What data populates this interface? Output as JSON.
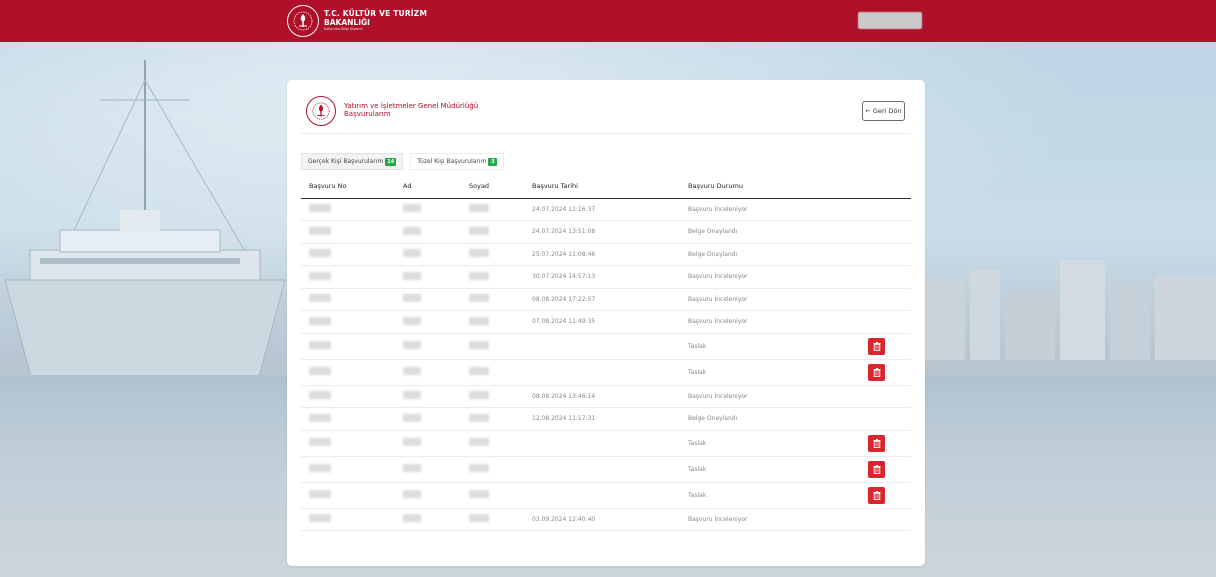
{
  "header": {
    "ministry_line1": "T.C. KÜLTÜR VE TURİZM",
    "ministry_line2": "BAKANLIĞI",
    "ministry_line3": "Kalkınma Bilgi Sistemi"
  },
  "card": {
    "department": "Yatırım ve İşletmeler Genel Müdürlüğü",
    "page_title": "Başvurularım",
    "back_button": "← Geri Dön"
  },
  "tabs": [
    {
      "label": "Gerçek Kişi Başvurularım",
      "count": "14",
      "active": true
    },
    {
      "label": "Tüzel Kişi Başvurularım",
      "count": "3",
      "active": false
    }
  ],
  "table": {
    "columns": [
      "Başvuru No",
      "Ad",
      "Soyad",
      "Başvuru Tarihi",
      "Başvuru Durumu"
    ],
    "rows": [
      {
        "date": "24.07.2024 12:16:37",
        "status": "Başvuru İnceleniyor",
        "deletable": false
      },
      {
        "date": "24.07.2024 13:51:08",
        "status": "Belge Onaylandı",
        "deletable": false
      },
      {
        "date": "25.07.2024 11:08:46",
        "status": "Belge Onaylandı",
        "deletable": false
      },
      {
        "date": "30.07.2024 14:57:13",
        "status": "Başvuru İnceleniyor",
        "deletable": false
      },
      {
        "date": "08.08.2024 17:22:57",
        "status": "Başvuru İnceleniyor",
        "deletable": false
      },
      {
        "date": "07.08.2024 11:49:35",
        "status": "Başvuru İnceleniyor",
        "deletable": false
      },
      {
        "date": "",
        "status": "Taslak",
        "deletable": true
      },
      {
        "date": "",
        "status": "Taslak",
        "deletable": true
      },
      {
        "date": "08.08.2024 13:46:14",
        "status": "Başvuru İnceleniyor",
        "deletable": false
      },
      {
        "date": "12.08.2024 11:17:31",
        "status": "Belge Onaylandı",
        "deletable": false
      },
      {
        "date": "",
        "status": "Taslak",
        "deletable": true
      },
      {
        "date": "",
        "status": "Taslak",
        "deletable": true
      },
      {
        "date": "",
        "status": "Taslak",
        "deletable": true
      },
      {
        "date": "03.09.2024 12:40:40",
        "status": "Başvuru İnceleniyor",
        "deletable": false
      }
    ]
  },
  "colors": {
    "brand_red": "#b0102a",
    "delete_red": "#d9262e",
    "badge_green": "#28a745"
  },
  "icons": {
    "seal": "ministry-seal-icon",
    "delete": "trash-icon"
  }
}
